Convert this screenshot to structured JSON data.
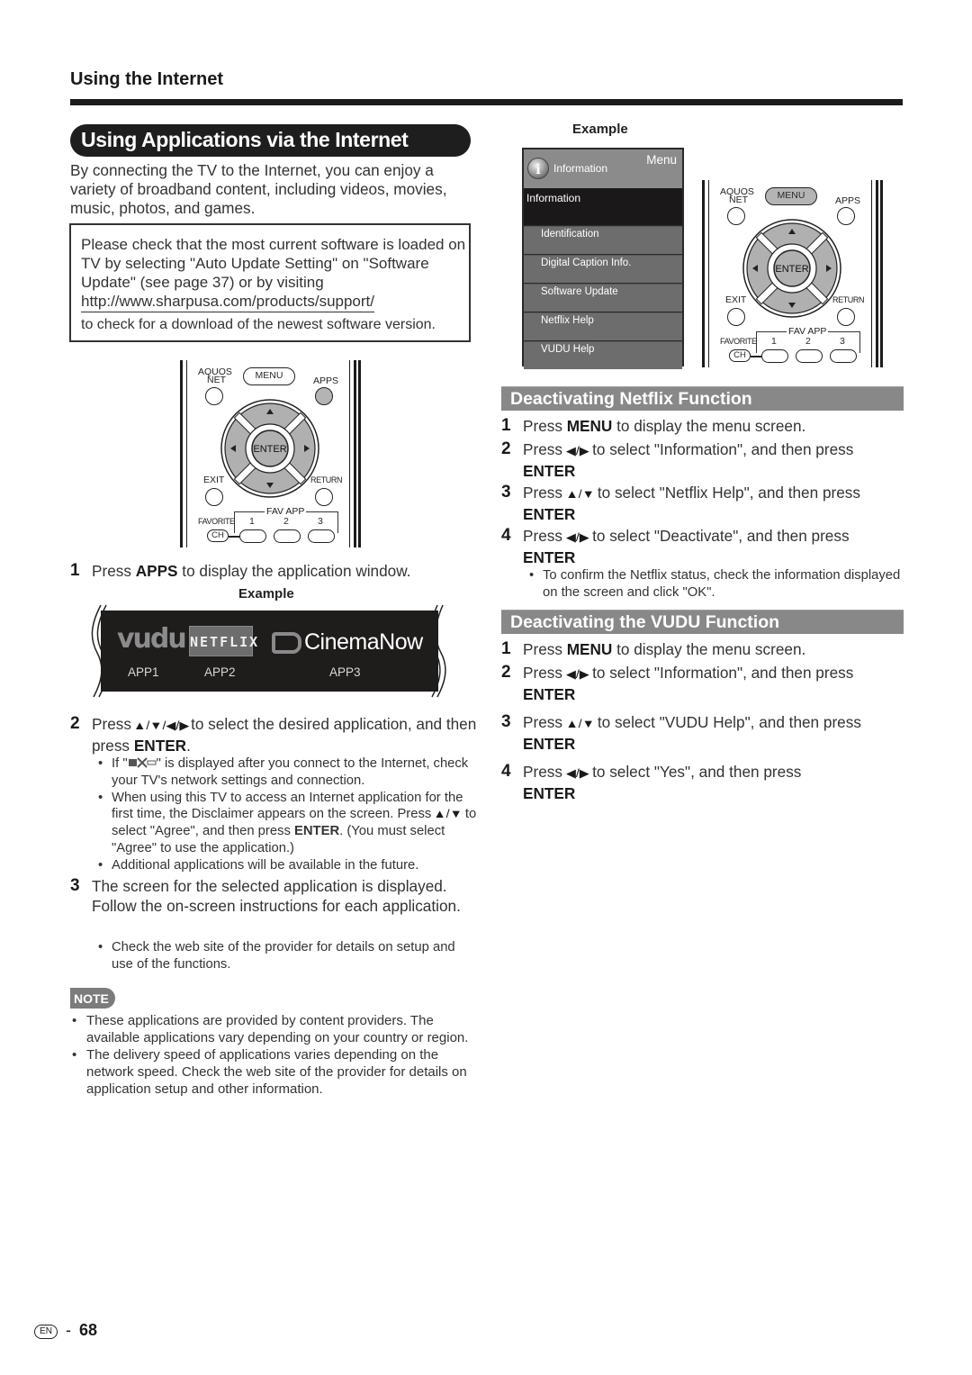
{
  "header": {
    "section_label": "Using the Internet",
    "title": "Using Applications via the Internet"
  },
  "intro": "By connecting the TV to the Internet, you can enjoy a variety of broadband content, including videos, movies, music, photos, and games.",
  "notice": {
    "text": "Please check that the most current software is loaded on TV by selecting \"Auto Update Setting\" on \"Software Update\" (see page 37) or by visiting",
    "url": "http://www.sharpusa.com/products/support/",
    "tail": "to check for a download of the newest software version."
  },
  "remote": {
    "aquos_net": [
      "AQUOS",
      "NET"
    ],
    "menu": "MENU",
    "apps": "APPS",
    "enter": "ENTER",
    "exit": "EXIT",
    "return": "RETURN",
    "fav_app": "FAV APP",
    "favorite": "FAVORITE",
    "ch": "CH",
    "fav_numbers": [
      "1",
      "2",
      "3"
    ]
  },
  "left_steps": {
    "step1": {
      "num": "1",
      "pre": "Press ",
      "bold": "APPS",
      "post": " to display the application window."
    },
    "example_label": "Example",
    "apps": [
      {
        "logo": "vudu",
        "label": "APP1"
      },
      {
        "logo": "NETFLIX",
        "label": "APP2"
      },
      {
        "logo": "CinemaNow",
        "label": "APP3"
      }
    ],
    "step2": {
      "num": "2",
      "pre": "Press ",
      "arrows": "▲/▼/◀/▶",
      "post": " to select the desired application, and then press ",
      "bold": "ENTER",
      "end": ".",
      "bullets": [
        {
          "pre": "If \"",
          "icon": "network-error-icon",
          "post": "\" is displayed after you connect to the Internet, check your TV's network settings and connection."
        },
        {
          "pre": "When using this TV to access an Internet application for the first time, the Disclaimer appears on the screen. Press ",
          "arrows": "▲/▼",
          "mid": " to select \"Agree\", and then press ",
          "bold": "ENTER",
          "post": ". (You must select \"Agree\" to use the application.)"
        },
        {
          "pre": "Additional applications will be available in the future."
        }
      ]
    },
    "step3": {
      "num": "3",
      "text": "The screen for the selected application is displayed. Follow the on-screen instructions for each application.",
      "bullets": [
        "Check the web site of the provider for details on setup and use of the functions."
      ]
    }
  },
  "note": {
    "label": "NOTE",
    "items": [
      "These applications are provided by content providers. The available applications vary depending on your country or region.",
      "The delivery speed of applications varies depending on the network speed. Check the web site of the provider for details on application setup and other information."
    ]
  },
  "menu_example": {
    "label": "Example",
    "header_icon_title": "Information",
    "header_menu": "Menu",
    "sub_title": "Information",
    "items": [
      "Identification",
      "Digital Caption Info.",
      "Software Update",
      "Netflix Help",
      "VUDU Help"
    ]
  },
  "netflix_section": {
    "title": "Deactivating Netflix Function",
    "steps": [
      {
        "num": "1",
        "pre": "Press ",
        "bold1": "MENU",
        "post": " to display the menu screen."
      },
      {
        "num": "2",
        "pre": "Press ",
        "arrows": "◀/▶",
        "post": " to select \"Information\", and then press",
        "bold2": "ENTER"
      },
      {
        "num": "3",
        "pre": "Press ",
        "arrows": "▲/▼",
        "post": " to select \"Netflix Help\", and then press",
        "bold2": "ENTER"
      },
      {
        "num": "4",
        "pre": "Press ",
        "arrows": "◀/▶",
        "post": " to select \"Deactivate\", and then press",
        "bold2": "ENTER"
      }
    ],
    "bullet": "To confirm the Netflix status, check the information displayed on the screen and click \"OK\"."
  },
  "vudu_section": {
    "title": "Deactivating the VUDU Function",
    "steps": [
      {
        "num": "1",
        "pre": "Press ",
        "bold1": "MENU",
        "post": " to display the menu screen."
      },
      {
        "num": "2",
        "pre": "Press ",
        "arrows": "◀/▶",
        "post": " to select \"Information\", and then press",
        "bold2": "ENTER"
      },
      {
        "num": "3",
        "pre": "Press ",
        "arrows": "▲/▼",
        "post": " to select \"VUDU Help\", and then press",
        "bold2": "ENTER"
      },
      {
        "num": "4",
        "pre": "Press ",
        "arrows": "◀/▶",
        "post": " to select \"Yes\", and then press",
        "bold2": "ENTER"
      }
    ]
  },
  "footer": {
    "lang_badge": "EN",
    "separator": "-",
    "page_number": "68"
  }
}
